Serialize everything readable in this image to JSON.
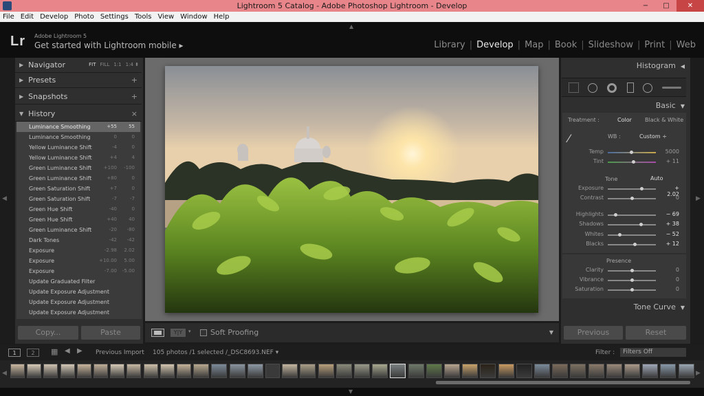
{
  "window": {
    "title": "Lightroom 5 Catalog - Adobe Photoshop Lightroom - Develop",
    "controls": [
      "−",
      "□",
      "✕"
    ]
  },
  "menu": [
    "File",
    "Edit",
    "Develop",
    "Photo",
    "Settings",
    "Tools",
    "View",
    "Window",
    "Help"
  ],
  "header": {
    "logo": "Lr",
    "brand": "Adobe Lightroom 5",
    "mobile": "Get started with Lightroom mobile ▸",
    "modules": [
      "Library",
      "Develop",
      "Map",
      "Book",
      "Slideshow",
      "Print",
      "Web"
    ],
    "active_module": "Develop"
  },
  "left_panel": {
    "navigator": {
      "label": "Navigator",
      "options": [
        "FIT",
        "FILL",
        "1:1",
        "1:4 ⬍"
      ]
    },
    "presets": {
      "label": "Presets",
      "ctrl": "+"
    },
    "snapshots": {
      "label": "Snapshots",
      "ctrl": "+"
    },
    "history": {
      "label": "History",
      "ctrl": "×"
    },
    "history_items": [
      {
        "name": "Luminance Smoothing",
        "v1": "+55",
        "v2": "55",
        "selected": true
      },
      {
        "name": "Luminance Smoothing",
        "v1": "0",
        "v2": "0"
      },
      {
        "name": "Yellow Luminance Shift",
        "v1": "-4",
        "v2": "0"
      },
      {
        "name": "Yellow Luminance Shift",
        "v1": "+4",
        "v2": "4"
      },
      {
        "name": "Green Luminance Shift",
        "v1": "+100",
        "v2": "-100"
      },
      {
        "name": "Green Luminance Shift",
        "v1": "+80",
        "v2": "0"
      },
      {
        "name": "Green Saturation Shift",
        "v1": "+7",
        "v2": "0"
      },
      {
        "name": "Green Saturation Shift",
        "v1": "-7",
        "v2": "-7"
      },
      {
        "name": "Green Hue Shift",
        "v1": "-40",
        "v2": "0"
      },
      {
        "name": "Green Hue Shift",
        "v1": "+40",
        "v2": "40"
      },
      {
        "name": "Green Luminance Shift",
        "v1": "-20",
        "v2": "-80"
      },
      {
        "name": "Dark Tones",
        "v1": "-42",
        "v2": "-42"
      },
      {
        "name": "Exposure",
        "v1": "-2.98",
        "v2": "2.02"
      },
      {
        "name": "Exposure",
        "v1": "+10.00",
        "v2": "5.00"
      },
      {
        "name": "Exposure",
        "v1": "-7.00",
        "v2": "-5.00"
      },
      {
        "name": "Update Graduated Filter",
        "v1": "",
        "v2": ""
      },
      {
        "name": "Update Exposure Adjustment",
        "v1": "",
        "v2": ""
      },
      {
        "name": "Update Exposure Adjustment",
        "v1": "",
        "v2": ""
      },
      {
        "name": "Update Exposure Adjustment",
        "v1": "",
        "v2": ""
      }
    ],
    "copy_label": "Copy...",
    "paste_label": "Paste"
  },
  "toolbar": {
    "view_mode": "Y|Y",
    "dropdown": "▾",
    "soft_proofing_label": "Soft Proofing",
    "expand": "▼"
  },
  "right_panel": {
    "histogram": "Histogram",
    "basic": "Basic",
    "treatment_label": "Treatment :",
    "treatment_color": "Color",
    "treatment_bw": "Black & White",
    "wb_label": "WB :",
    "wb_value": "Custom ÷",
    "tone_label": "Tone",
    "auto_label": "Auto",
    "presence_label": "Presence",
    "tone_curve": "Tone Curve",
    "sliders": [
      {
        "label": "Temp",
        "value": "5000",
        "pos": 0.48
      },
      {
        "label": "Tint",
        "value": "+ 11",
        "pos": 0.53
      },
      {
        "label": "Exposure",
        "value": "+ 2.02",
        "pos": 0.7,
        "bright": true
      },
      {
        "label": "Contrast",
        "value": "0",
        "pos": 0.5
      },
      {
        "label": "Highlights",
        "value": "− 69",
        "pos": 0.16,
        "bright": true
      },
      {
        "label": "Shadows",
        "value": "+ 38",
        "pos": 0.69,
        "bright": true
      },
      {
        "label": "Whites",
        "value": "− 52",
        "pos": 0.24,
        "bright": true
      },
      {
        "label": "Blacks",
        "value": "+ 12",
        "pos": 0.56,
        "bright": true
      },
      {
        "label": "Clarity",
        "value": "0",
        "pos": 0.5
      },
      {
        "label": "Vibrance",
        "value": "0",
        "pos": 0.5
      },
      {
        "label": "Saturation",
        "value": "0",
        "pos": 0.5
      }
    ],
    "previous_label": "Previous",
    "reset_label": "Reset"
  },
  "filmstrip_bar": {
    "page1": "1",
    "page2": "2",
    "source": "Previous Import",
    "info": "105 photos /1 selected /_DSC8693.NEF ▾",
    "filter_label": "Filter :",
    "filter_value": "Filters Off"
  },
  "colors": {
    "accent": "#e8858a",
    "panel": "#2f2f2f",
    "selected_row": "#656565"
  }
}
